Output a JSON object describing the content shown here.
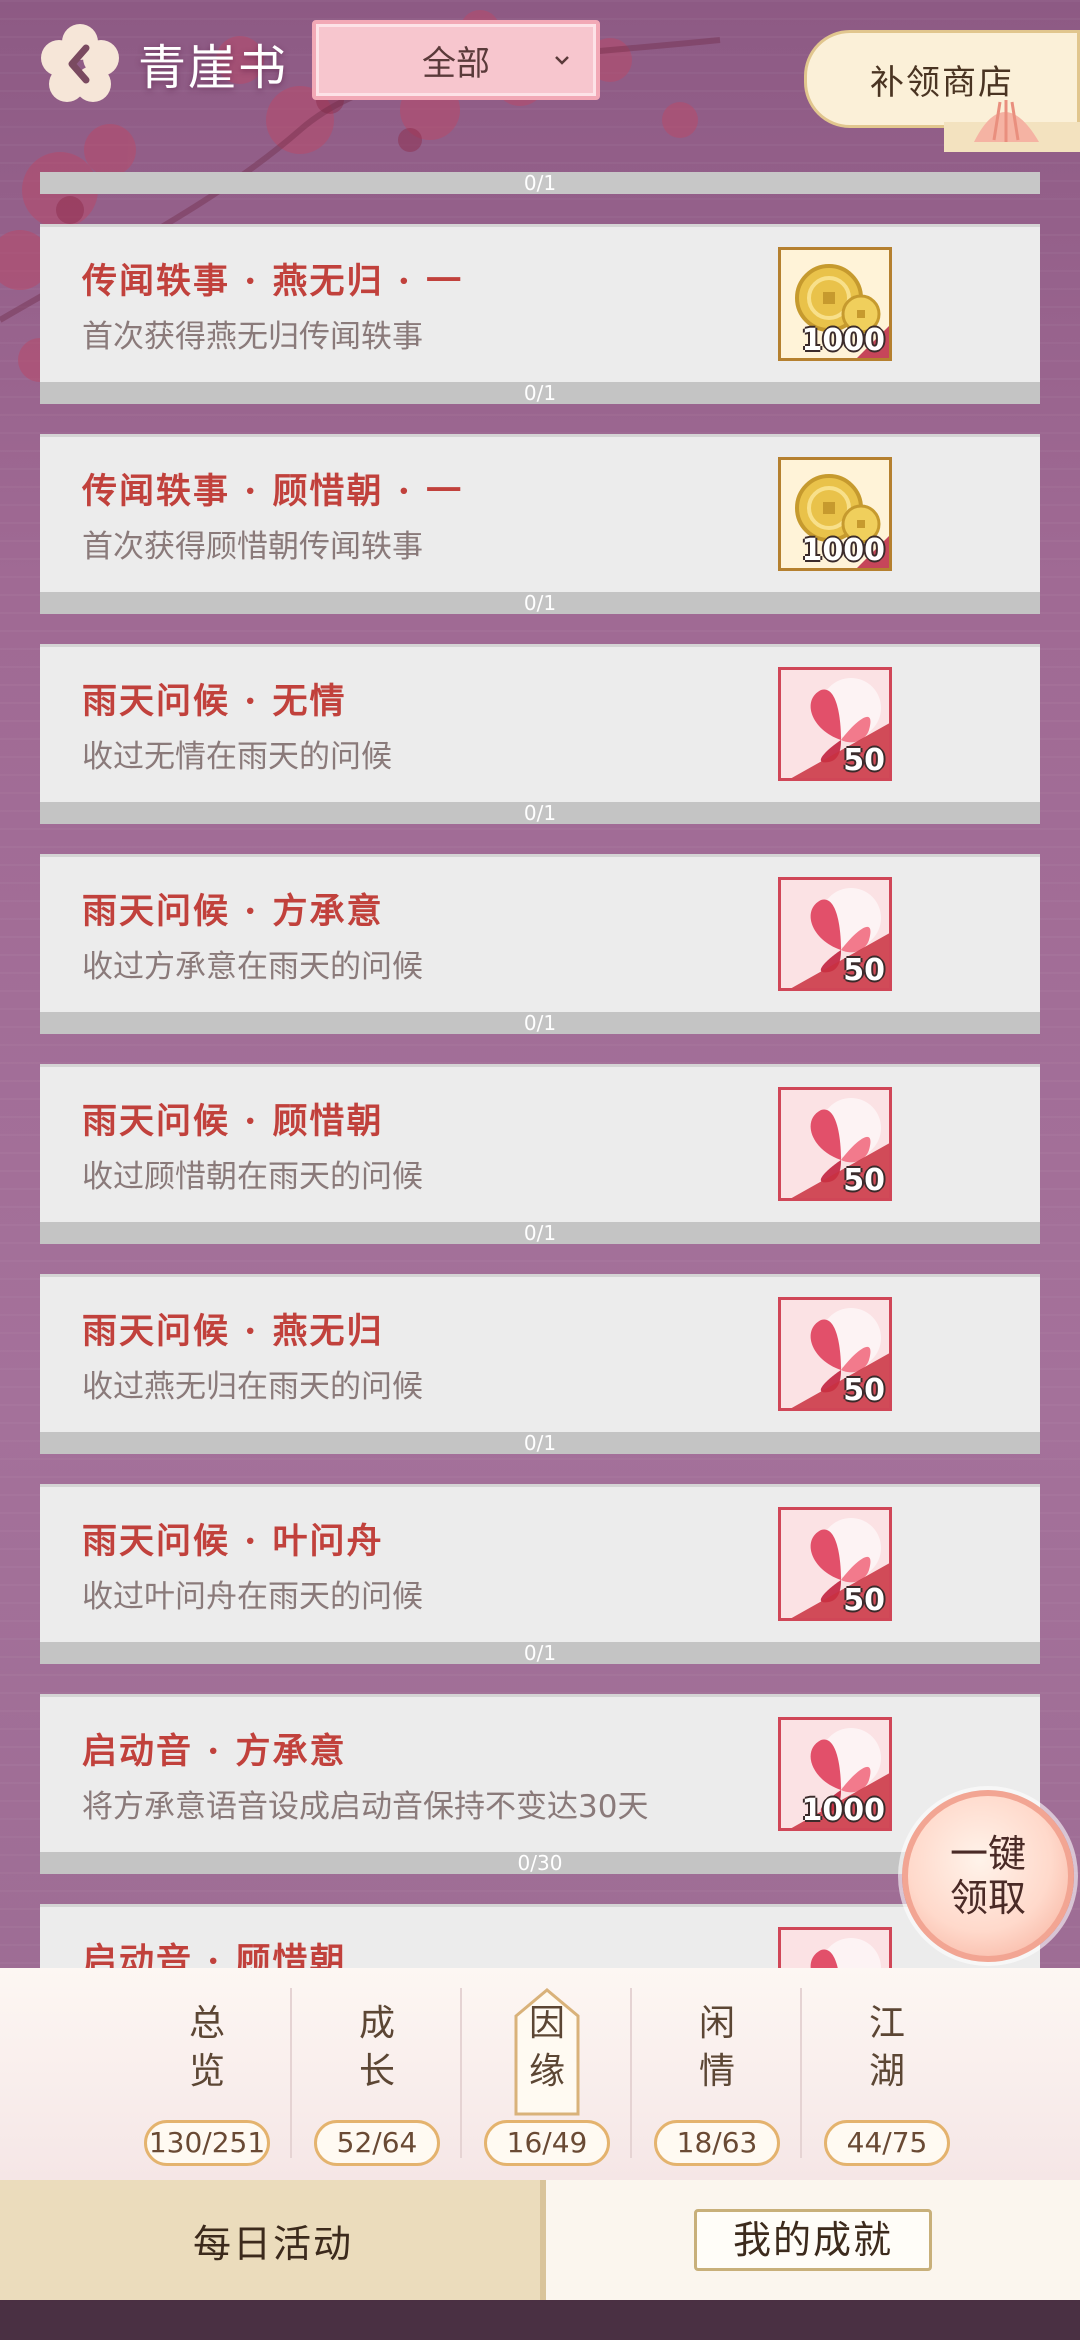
{
  "header": {
    "title": "青崖书",
    "filter_selected": "全部",
    "shop_label": "补领商店"
  },
  "top_progress": "0/1",
  "achievements": [
    {
      "title": "传闻轶事 · 燕无归 · 一",
      "desc": "首次获得燕无归传闻轶事",
      "reward_icon": "coin-icon",
      "reward_qty": "1000",
      "progress": "0/1"
    },
    {
      "title": "传闻轶事 · 顾惜朝 · 一",
      "desc": "首次获得顾惜朝传闻轶事",
      "reward_icon": "coin-icon",
      "reward_qty": "1000",
      "progress": "0/1"
    },
    {
      "title": "雨天问候 · 无情",
      "desc": "收过无情在雨天的问候",
      "reward_icon": "butterfly-icon",
      "reward_qty": "50",
      "progress": "0/1"
    },
    {
      "title": "雨天问候 · 方承意",
      "desc": "收过方承意在雨天的问候",
      "reward_icon": "butterfly-icon",
      "reward_qty": "50",
      "progress": "0/1"
    },
    {
      "title": "雨天问候 · 顾惜朝",
      "desc": "收过顾惜朝在雨天的问候",
      "reward_icon": "butterfly-icon",
      "reward_qty": "50",
      "progress": "0/1"
    },
    {
      "title": "雨天问候 · 燕无归",
      "desc": "收过燕无归在雨天的问候",
      "reward_icon": "butterfly-icon",
      "reward_qty": "50",
      "progress": "0/1"
    },
    {
      "title": "雨天问候 · 叶问舟",
      "desc": "收过叶问舟在雨天的问候",
      "reward_icon": "butterfly-icon",
      "reward_qty": "50",
      "progress": "0/1"
    },
    {
      "title": "启动音 · 方承意",
      "desc": "将方承意语音设成启动音保持不变达30天",
      "reward_icon": "butterfly-icon",
      "reward_qty": "1000",
      "progress": "0/30"
    },
    {
      "title": "启动音 · 顾惜朝",
      "desc": "",
      "reward_icon": "butterfly-icon",
      "reward_qty": "",
      "progress": ""
    }
  ],
  "claim_all_label": "一键领取",
  "categories": [
    {
      "label": "总览",
      "count": "130/251",
      "active": false
    },
    {
      "label": "成长",
      "count": "52/64",
      "active": false
    },
    {
      "label": "因缘",
      "count": "16/49",
      "active": true
    },
    {
      "label": "闲情",
      "count": "18/63",
      "active": false
    },
    {
      "label": "江湖",
      "count": "44/75",
      "active": false
    }
  ],
  "nav": {
    "daily_label": "每日活动",
    "mine_label": "我的成就"
  },
  "colors": {
    "title_red": "#c1413c",
    "bg_purple": "#a06a94",
    "coin_gold": "#e9c24a",
    "butterfly_pink": "#e2506a"
  }
}
